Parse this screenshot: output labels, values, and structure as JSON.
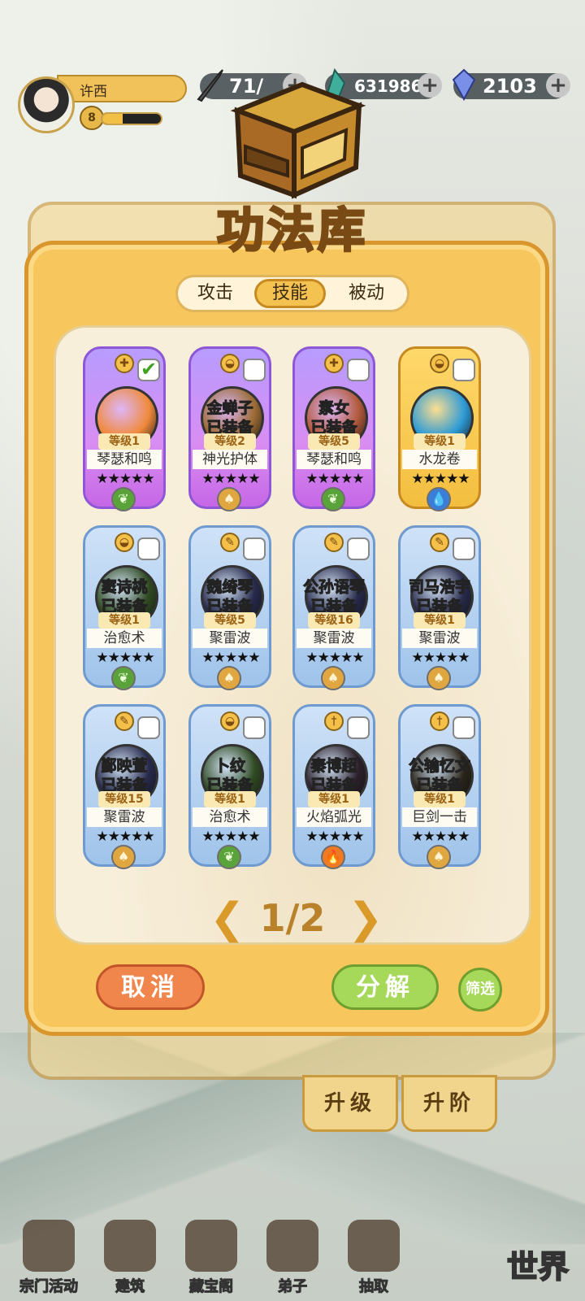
{
  "player": {
    "name": "许西",
    "level": "8",
    "exp": 0.35
  },
  "resources": [
    {
      "id": "stamina",
      "value": "71/"
    },
    {
      "id": "spirit-stone",
      "value": "631986"
    },
    {
      "id": "gem",
      "value": "2103"
    }
  ],
  "title": "功法库",
  "tabs": [
    {
      "label": "攻击",
      "active": false
    },
    {
      "label": "技能",
      "active": true
    },
    {
      "label": "被动",
      "active": false
    }
  ],
  "cards": [
    {
      "rarity": "purple",
      "top_icon": "heal",
      "checked": true,
      "holder": "",
      "equipped": "",
      "level": "等级1",
      "skill": "琴瑟和鸣",
      "element": "wood",
      "orb": "#f08a3c"
    },
    {
      "rarity": "purple",
      "top_icon": "bowl",
      "checked": false,
      "holder": "金蝉子",
      "equipped": "已装备",
      "level": "等级2",
      "skill": "神光护体",
      "element": "earth",
      "orb": "#9b6b34"
    },
    {
      "rarity": "purple",
      "top_icon": "heal",
      "checked": false,
      "holder": "素女",
      "equipped": "已装备",
      "level": "等级5",
      "skill": "琴瑟和鸣",
      "element": "wood",
      "orb": "#b25a3c"
    },
    {
      "rarity": "gold",
      "top_icon": "bowl",
      "checked": false,
      "holder": "",
      "equipped": "",
      "level": "等级1",
      "skill": "水龙卷",
      "element": "water",
      "orb": "#2e9bd6"
    },
    {
      "rarity": "blue",
      "top_icon": "bowl",
      "checked": false,
      "holder": "窦诗桃",
      "equipped": "已装备",
      "level": "等级1",
      "skill": "治愈术",
      "element": "wood",
      "orb": "#2f4a22"
    },
    {
      "rarity": "blue",
      "top_icon": "brush",
      "checked": false,
      "holder": "魏绮琴",
      "equipped": "已装备",
      "level": "等级5",
      "skill": "聚雷波",
      "element": "earth",
      "orb": "#26294a"
    },
    {
      "rarity": "blue",
      "top_icon": "brush",
      "checked": false,
      "holder": "公孙语琴",
      "equipped": "已装备",
      "level": "等级16",
      "skill": "聚雷波",
      "element": "earth",
      "orb": "#26294a"
    },
    {
      "rarity": "blue",
      "top_icon": "brush",
      "checked": false,
      "holder": "司马浩宇",
      "equipped": "已装备",
      "level": "等级1",
      "skill": "聚雷波",
      "element": "earth",
      "orb": "#26294a"
    },
    {
      "rarity": "blue",
      "top_icon": "brush",
      "checked": false,
      "holder": "鄞映萱",
      "equipped": "已装备",
      "level": "等级15",
      "skill": "聚雷波",
      "element": "earth",
      "orb": "#26294a"
    },
    {
      "rarity": "blue",
      "top_icon": "bowl",
      "checked": false,
      "holder": "卜纹",
      "equipped": "已装备",
      "level": "等级1",
      "skill": "治愈术",
      "element": "wood",
      "orb": "#2f4a22"
    },
    {
      "rarity": "blue",
      "top_icon": "sword",
      "checked": false,
      "holder": "秦博超",
      "equipped": "已装备",
      "level": "等级1",
      "skill": "火焰弧光",
      "element": "fire",
      "orb": "#2a1f2a"
    },
    {
      "rarity": "blue",
      "top_icon": "sword",
      "checked": false,
      "holder": "公输忆文",
      "equipped": "已装备",
      "level": "等级1",
      "skill": "巨剑一击",
      "element": "earth",
      "orb": "#2a2418"
    }
  ],
  "stars": "★★★★★",
  "pager": {
    "text": "1/2",
    "prev": "❮",
    "next": "❯"
  },
  "buttons": {
    "cancel": "取消",
    "decompose": "分解",
    "filter": "筛选",
    "upgrade": "升级",
    "advance": "升阶"
  },
  "nav": [
    {
      "label": "宗门活动"
    },
    {
      "label": "建筑"
    },
    {
      "label": "藏宝阁"
    },
    {
      "label": "弟子"
    },
    {
      "label": "抽取"
    }
  ],
  "world_label": "世界",
  "colors": {
    "panel": "#f7c65c",
    "panel_border": "#d9962d",
    "title_stroke": "#7a4a14",
    "cancel": "#f0864c",
    "confirm": "#a6d85a"
  }
}
